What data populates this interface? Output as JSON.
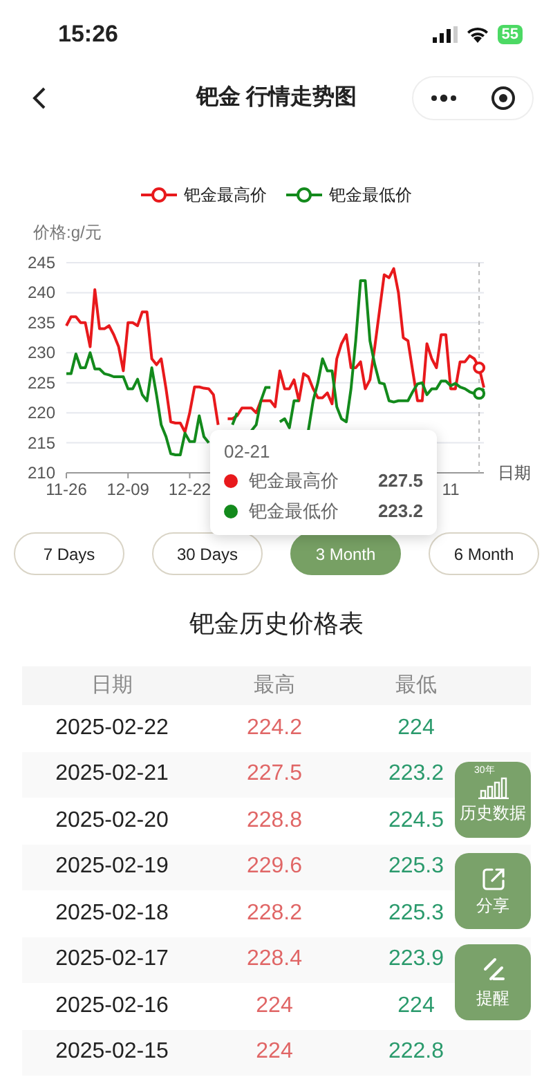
{
  "status_bar": {
    "time": "15:26",
    "battery": "55"
  },
  "nav": {
    "title": "钯金 行情走势图"
  },
  "chart": {
    "chart_data": {
      "type": "line",
      "ylabel": "价格:g/元",
      "xlabel": "日期",
      "grid": true,
      "categories": [
        "11-26",
        null,
        null,
        null,
        null,
        null,
        null,
        null,
        null,
        null,
        null,
        null,
        null,
        "12-09",
        null,
        null,
        null,
        null,
        null,
        null,
        null,
        null,
        null,
        null,
        null,
        null,
        "12-22",
        null,
        null,
        null,
        null,
        null,
        null,
        null,
        null,
        null,
        null,
        null,
        null,
        null,
        null,
        null,
        null,
        null,
        null,
        null,
        null,
        null,
        null,
        null,
        null,
        null,
        null,
        null,
        null,
        null,
        null,
        null,
        null,
        null,
        null,
        null,
        null,
        null,
        null,
        null,
        null,
        null,
        null,
        null,
        null,
        null,
        null,
        null,
        null,
        null,
        null,
        "11",
        null,
        null,
        null,
        null,
        null,
        null,
        null,
        null,
        null,
        null,
        null
      ],
      "series": [
        {
          "name": "钯金最高价",
          "color": "#e8191c",
          "values": [
            234.5,
            236,
            236,
            235,
            235,
            231,
            240.5,
            234,
            234,
            234.5,
            233,
            231,
            227,
            235,
            235,
            234.5,
            236.8,
            236.8,
            229,
            228,
            229,
            224,
            218.5,
            218.3,
            218.3,
            216.8,
            220,
            224.3,
            224.3,
            224.1,
            224,
            223,
            218,
            null,
            219,
            219,
            219.5,
            220.8,
            220.8,
            220.8,
            220,
            222,
            222,
            222,
            221,
            227,
            224,
            224,
            225.5,
            222,
            226.5,
            226,
            224,
            222.5,
            222.5,
            223.3,
            221.5,
            229,
            231.5,
            233,
            227.5,
            227.5,
            228.5,
            224,
            225.5,
            231,
            237,
            243,
            242.5,
            244,
            240,
            232.5,
            232,
            227,
            222,
            222,
            231.5,
            229,
            227.5,
            233,
            233,
            224,
            224,
            228.5,
            228.5,
            229.5,
            229,
            227.5,
            224.2
          ]
        },
        {
          "name": "钯金最低价",
          "color": "#138a1c",
          "values": [
            226.5,
            226.5,
            229.8,
            227.5,
            227.5,
            230,
            227.3,
            227.3,
            226.5,
            226.3,
            226,
            226,
            226,
            224,
            224,
            225.6,
            223,
            222,
            227.5,
            223,
            218,
            216,
            213.2,
            213,
            213,
            216.6,
            215.2,
            215.2,
            219.5,
            216,
            215,
            null,
            null,
            null,
            null,
            218,
            220,
            null,
            null,
            217,
            218,
            222,
            224.2,
            224.2,
            null,
            218.5,
            219,
            217.5,
            222,
            222,
            null,
            217,
            222,
            225,
            229,
            227,
            227,
            221,
            219,
            218.5,
            224,
            232,
            242,
            242,
            232,
            228,
            225,
            224.8,
            222,
            221.8,
            222,
            222,
            222,
            223.5,
            224.8,
            225,
            223,
            224,
            224,
            225.3,
            225.3,
            224.5,
            224.9,
            224.3,
            224,
            223.5,
            223.2,
            223.2,
            224
          ]
        }
      ],
      "ylim": [
        210,
        245
      ],
      "yticks": [
        210,
        215,
        220,
        225,
        230,
        235,
        240,
        245
      ]
    },
    "tooltip": {
      "date": "02-21",
      "rows": [
        {
          "name": "钯金最高价",
          "value": "227.5",
          "color": "#e8191c"
        },
        {
          "name": "钯金最低价",
          "value": "223.2",
          "color": "#138a1c"
        }
      ]
    }
  },
  "ranges": [
    {
      "label": "7 Days",
      "selected": false
    },
    {
      "label": "30 Days",
      "selected": false
    },
    {
      "label": "3 Month",
      "selected": true
    },
    {
      "label": "6 Month",
      "selected": false
    }
  ],
  "table": {
    "title": "钯金历史价格表",
    "columns": [
      "日期",
      "最高",
      "最低"
    ],
    "rows": [
      {
        "date": "2025-02-22",
        "high": "224.2",
        "low": "224"
      },
      {
        "date": "2025-02-21",
        "high": "227.5",
        "low": "223.2"
      },
      {
        "date": "2025-02-20",
        "high": "228.8",
        "low": "224.5"
      },
      {
        "date": "2025-02-19",
        "high": "229.6",
        "low": "225.3"
      },
      {
        "date": "2025-02-18",
        "high": "228.2",
        "low": "225.3"
      },
      {
        "date": "2025-02-17",
        "high": "228.4",
        "low": "223.9"
      },
      {
        "date": "2025-02-16",
        "high": "224",
        "low": "224"
      },
      {
        "date": "2025-02-15",
        "high": "224",
        "low": "222.8"
      }
    ]
  },
  "float_buttons": [
    {
      "kind": "history",
      "badge": "30年",
      "label": "历史数据"
    },
    {
      "kind": "share",
      "label": "分享"
    },
    {
      "kind": "alert",
      "label": "提醒"
    }
  ]
}
